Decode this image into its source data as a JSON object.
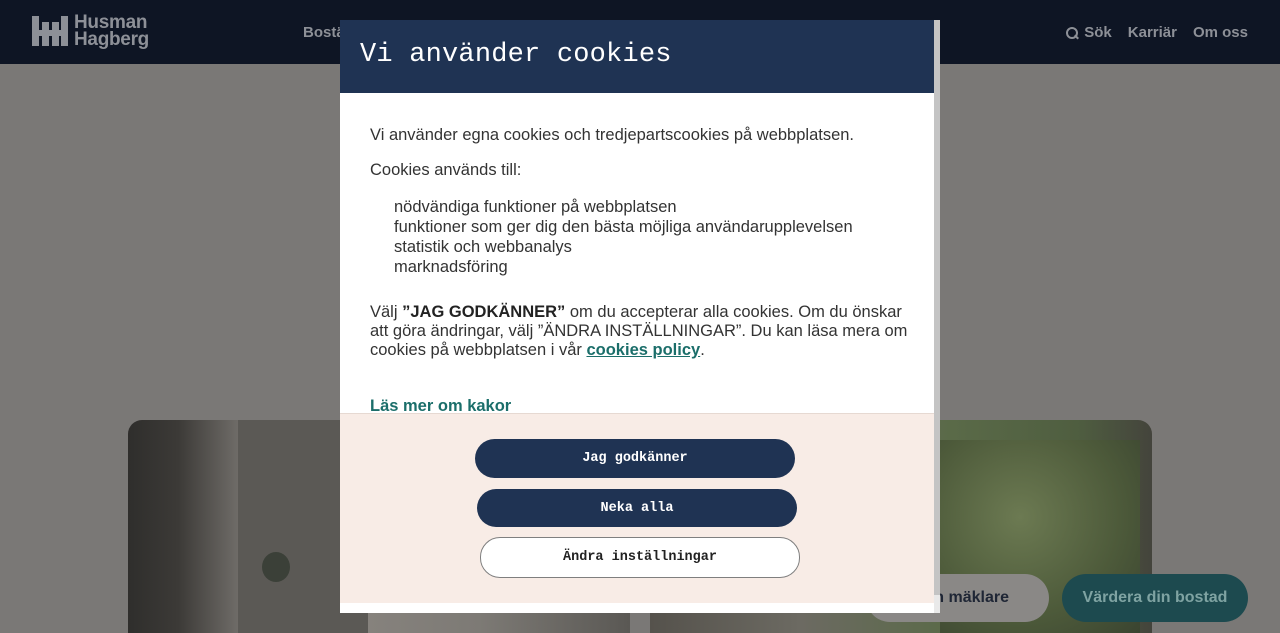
{
  "background": {
    "logo": {
      "line1": "Husman",
      "line2": "Hagberg"
    },
    "nav_partial": "Bostä",
    "top_nav": {
      "search_label": "Sök",
      "careers_label": "Karriär",
      "about_label": "Om oss"
    },
    "fab": {
      "agent_partial": "n mäklare",
      "valuation_label": "Värdera din bostad"
    }
  },
  "modal": {
    "title": "Vi använder cookies",
    "intro": "Vi använder egna cookies och tredjepartscookies på webbplatsen.",
    "used_for_label": "Cookies används till:",
    "uses": [
      "nödvändiga funktioner på webbplatsen",
      "funktioner som ger dig den bästa möjliga användarupplevelsen",
      "statistik och webbanalys",
      "marknadsföring"
    ],
    "choose_prefix": "Välj ",
    "choose_bold": "”JAG GODKÄNNER”",
    "choose_middle": " om du accepterar alla cookies. Om du önskar att göra ändringar, välj ”ÄNDRA INSTÄLLNINGAR”. Du kan läsa mera om cookies på webbplatsen i vår ",
    "policy_link": "cookies policy",
    "choose_suffix": ".",
    "read_more": "Läs mer om kakor",
    "buttons": {
      "accept": "Jag godkänner",
      "deny": "Neka alla",
      "settings": "Ändra inställningar"
    }
  }
}
